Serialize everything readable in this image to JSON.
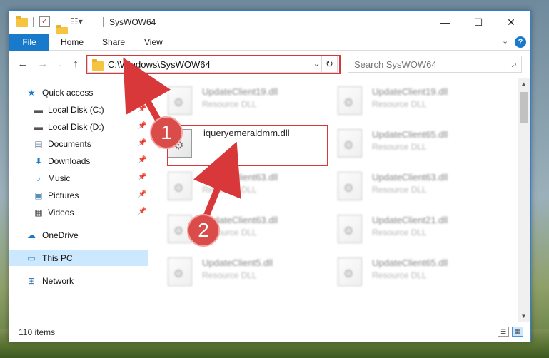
{
  "window": {
    "title": "SysWOW64",
    "minimize_icon": "minimize-icon",
    "maximize_icon": "maximize-icon",
    "close_icon": "close-icon"
  },
  "ribbon": {
    "file": "File",
    "tabs": [
      "Home",
      "Share",
      "View"
    ]
  },
  "address": {
    "path": "C:\\Windows\\SysWOW64",
    "search_placeholder": "Search SysWOW64"
  },
  "nav_pane": {
    "items": [
      {
        "label": "Quick access",
        "icon": "star-icon"
      },
      {
        "label": "Local Disk (C:)",
        "icon": "drive-icon",
        "pinned": true
      },
      {
        "label": "Local Disk (D:)",
        "icon": "drive-icon",
        "pinned": true
      },
      {
        "label": "Documents",
        "icon": "documents-icon",
        "pinned": true
      },
      {
        "label": "Downloads",
        "icon": "download-icon",
        "pinned": true
      },
      {
        "label": "Music",
        "icon": "music-icon",
        "pinned": true
      },
      {
        "label": "Pictures",
        "icon": "pictures-icon",
        "pinned": true
      },
      {
        "label": "Videos",
        "icon": "videos-icon",
        "pinned": true
      },
      {
        "label": "OneDrive",
        "icon": "cloud-icon"
      },
      {
        "label": "This PC",
        "icon": "computer-icon",
        "selected": true
      },
      {
        "label": "Network",
        "icon": "network-icon"
      }
    ]
  },
  "files": [
    {
      "name": "UpdateClient19.dll",
      "type": "Resource DLL"
    },
    {
      "name": "UpdateClient19.dll",
      "type": "Resource DLL"
    },
    {
      "name": "iqueryemeraldmm.dll",
      "type": ""
    },
    {
      "name": "UpdateClient65.dll",
      "type": "Resource DLL"
    },
    {
      "name": "UpdateClient63.dll",
      "type": "Resource DLL"
    },
    {
      "name": "UpdateClient63.dll",
      "type": "Resource DLL"
    },
    {
      "name": "UpdateClient63.dll",
      "type": "Resource DLL"
    },
    {
      "name": "UpdateClient21.dll",
      "type": "Resource DLL"
    },
    {
      "name": "UpdateClient5.dll",
      "type": "Resource DLL"
    },
    {
      "name": "UpdateClient65.dll",
      "type": "Resource DLL"
    }
  ],
  "status": {
    "item_count": "110 items"
  },
  "annotations": {
    "step1": "1",
    "step2": "2",
    "color": "#d9383a"
  }
}
